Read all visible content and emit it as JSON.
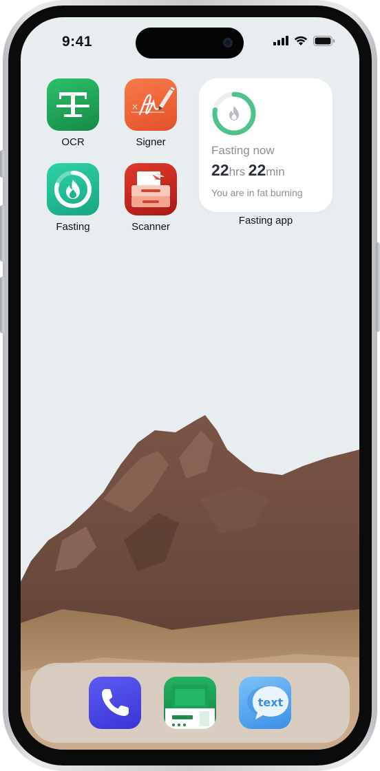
{
  "status_bar": {
    "time": "9:41"
  },
  "home": {
    "apps": [
      {
        "label": "OCR",
        "icon": "ocr-text-icon",
        "color": "#1fa35a"
      },
      {
        "label": "Signer",
        "icon": "signature-pen-icon",
        "color": "#f0643a"
      },
      {
        "label": "Fasting",
        "icon": "flame-ring-icon",
        "color": "#23b894"
      },
      {
        "label": "Scanner",
        "icon": "scanner-icon",
        "color": "#c92a23"
      }
    ],
    "widget": {
      "title": "Fasting now",
      "hours": "22",
      "hours_unit": "hrs",
      "minutes": "22",
      "minutes_unit": "min",
      "status": "You are in fat burning",
      "label": "Fasting app",
      "progress": 0.78,
      "accent": "#4cc38a"
    }
  },
  "dock": {
    "apps": [
      {
        "icon": "phone-icon",
        "color": "#4f47e8"
      },
      {
        "icon": "fax-icon",
        "color": "#1f9a52"
      },
      {
        "icon": "text-bubble-icon",
        "text": "text",
        "color": "#4a9be8"
      }
    ]
  }
}
